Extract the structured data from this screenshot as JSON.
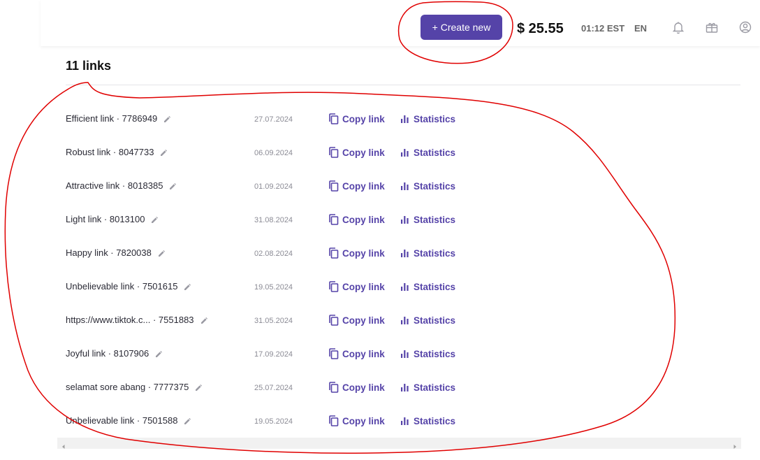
{
  "header": {
    "create_label": "+ Create new",
    "balance": "$ 25.55",
    "time": "01:12 EST",
    "language": "EN",
    "icons": [
      "bell-icon",
      "gift-icon",
      "user-icon"
    ]
  },
  "main": {
    "title": "11 links",
    "copy_label": "Copy link",
    "stats_label": "Statistics",
    "links": [
      {
        "name": "Efficient link · 7786949",
        "date": "27.07.2024"
      },
      {
        "name": "Robust link · 8047733",
        "date": "06.09.2024"
      },
      {
        "name": "Attractive link · 8018385",
        "date": "01.09.2024"
      },
      {
        "name": "Light link · 8013100",
        "date": "31.08.2024"
      },
      {
        "name": "Happy link · 7820038",
        "date": "02.08.2024"
      },
      {
        "name": "Unbelievable link · 7501615",
        "date": "19.05.2024"
      },
      {
        "name": "https://www.tiktok.c... · 7551883",
        "date": "31.05.2024"
      },
      {
        "name": "Joyful link · 8107906",
        "date": "17.09.2024"
      },
      {
        "name": "selamat sore abang · 7777375",
        "date": "25.07.2024"
      },
      {
        "name": "Unbelievable link · 7501588",
        "date": "19.05.2024"
      }
    ]
  },
  "colors": {
    "accent": "#5543a8",
    "annotation": "#e00000"
  }
}
